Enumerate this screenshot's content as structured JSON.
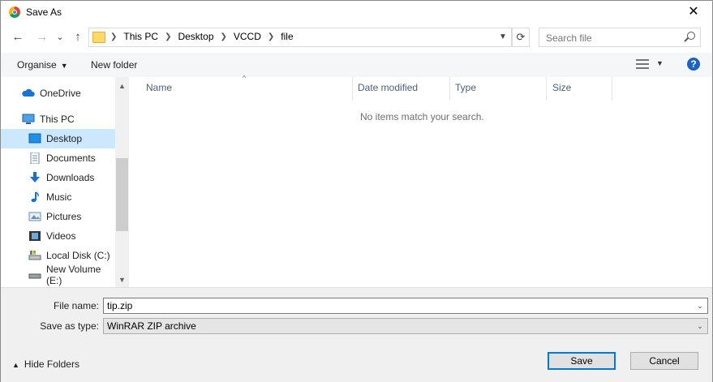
{
  "window": {
    "title": "Save As",
    "close_glyph": "✕"
  },
  "navigation": {
    "back_glyph": "←",
    "forward_glyph": "→",
    "recent_glyph": "⌄",
    "up_glyph": "↑",
    "breadcrumbs": [
      "This PC",
      "Desktop",
      "VCCD",
      "file"
    ],
    "search_placeholder": "Search file"
  },
  "toolbar": {
    "organise_label": "Organise",
    "new_folder_label": "New folder",
    "help_glyph": "?"
  },
  "sidebar": {
    "items": [
      {
        "label": "OneDrive",
        "icon": "cloud-icon",
        "selected": false
      },
      {
        "label": "This PC",
        "icon": "computer-icon",
        "selected": false
      },
      {
        "label": "Desktop",
        "icon": "desktop-icon",
        "selected": true
      },
      {
        "label": "Documents",
        "icon": "documents-icon",
        "selected": false
      },
      {
        "label": "Downloads",
        "icon": "download-icon",
        "selected": false
      },
      {
        "label": "Music",
        "icon": "music-icon",
        "selected": false
      },
      {
        "label": "Pictures",
        "icon": "pictures-icon",
        "selected": false
      },
      {
        "label": "Videos",
        "icon": "videos-icon",
        "selected": false
      },
      {
        "label": "Local Disk (C:)",
        "icon": "local-disk-icon",
        "selected": false
      },
      {
        "label": "New Volume (E:)",
        "icon": "drive-icon",
        "selected": false
      }
    ]
  },
  "file_list": {
    "columns": [
      "Name",
      "Date modified",
      "Type",
      "Size"
    ],
    "empty_message": "No items match your search."
  },
  "form": {
    "file_name_label": "File name:",
    "file_name_value": "tip.zip",
    "save_type_label": "Save as type:",
    "save_type_value": "WinRAR ZIP archive"
  },
  "footer": {
    "hide_folders_label": "Hide Folders",
    "save_label": "Save",
    "cancel_label": "Cancel"
  },
  "colors": {
    "selection": "#cce8ff",
    "accent": "#0078d7",
    "help": "#1d63c1"
  }
}
